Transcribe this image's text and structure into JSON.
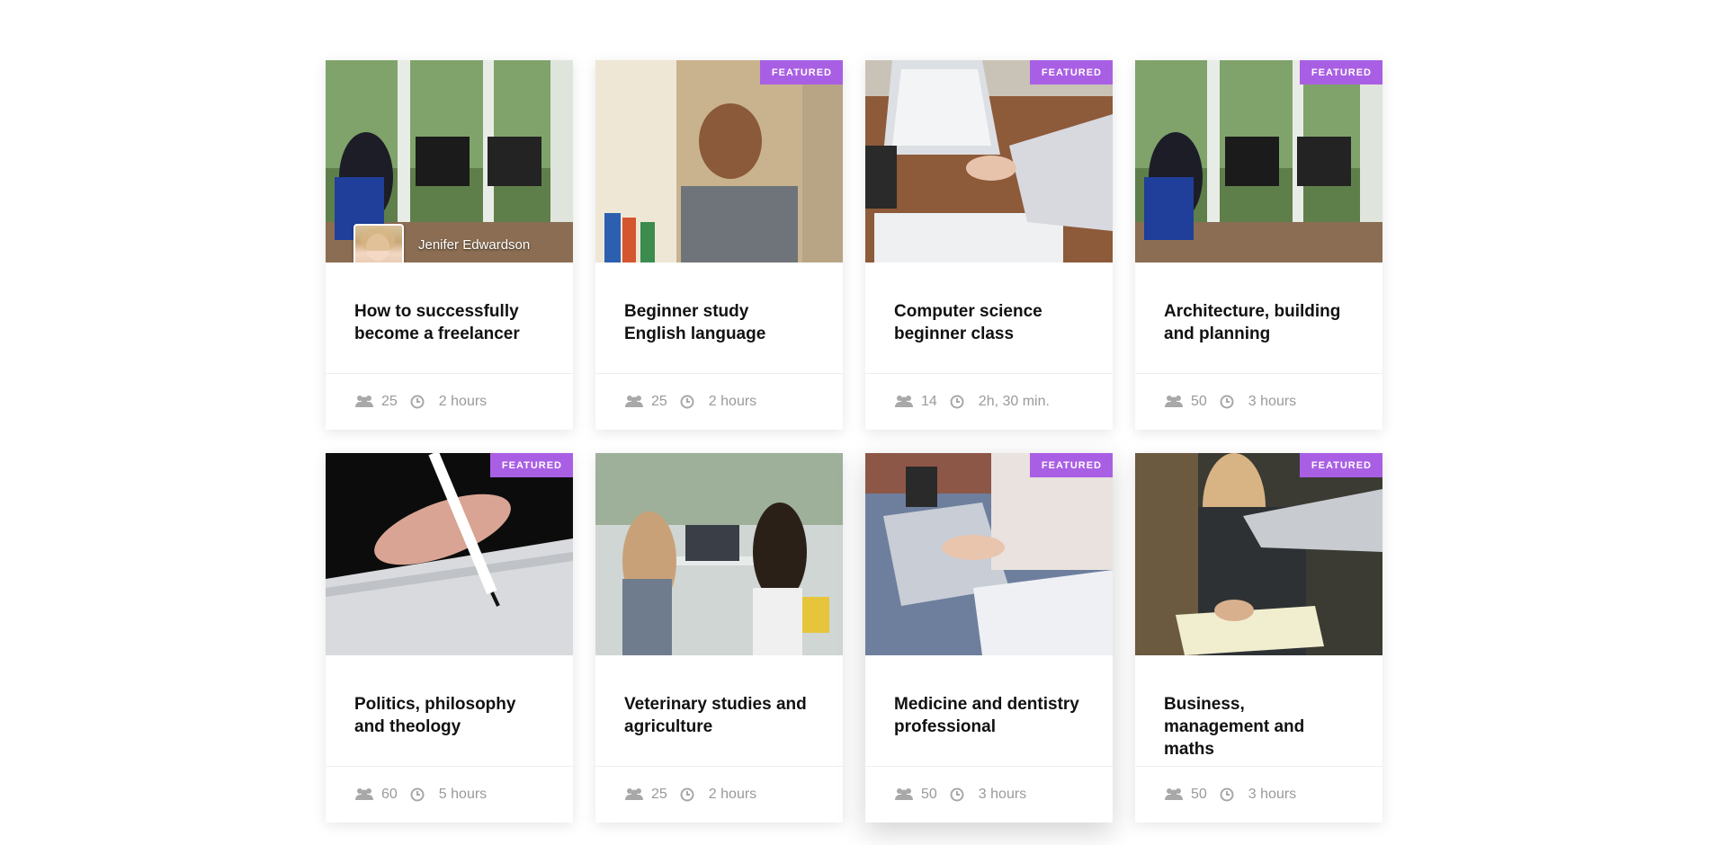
{
  "courses": [
    {
      "title": "How to successfully become a freelancer",
      "students": "25",
      "duration": "2 hours",
      "featured": false,
      "author": "Jenifer Edwardson"
    },
    {
      "title": "Beginner study English language",
      "students": "25",
      "duration": "2 hours",
      "featured": true,
      "badge": "FEATURED"
    },
    {
      "title": "Computer science beginner class",
      "students": "14",
      "duration": "2h, 30 min.",
      "featured": true,
      "badge": "FEATURED"
    },
    {
      "title": "Architecture, building and planning",
      "students": "50",
      "duration": "3 hours",
      "featured": true,
      "badge": "FEATURED"
    },
    {
      "title": "Politics, philosophy and theology",
      "students": "60",
      "duration": "5 hours",
      "featured": true,
      "badge": "FEATURED"
    },
    {
      "title": "Veterinary studies and agriculture",
      "students": "25",
      "duration": "2 hours",
      "featured": false
    },
    {
      "title": "Medicine and dentistry professional",
      "students": "50",
      "duration": "3 hours",
      "featured": true,
      "badge": "FEATURED"
    },
    {
      "title": "Business, management and maths",
      "students": "50",
      "duration": "3 hours",
      "featured": true,
      "badge": "FEATURED"
    }
  ],
  "colors": {
    "badge": "#a95fe4",
    "meta_text": "#9a9a9a"
  },
  "icons": {
    "students": "users-icon",
    "duration": "clock-icon"
  }
}
